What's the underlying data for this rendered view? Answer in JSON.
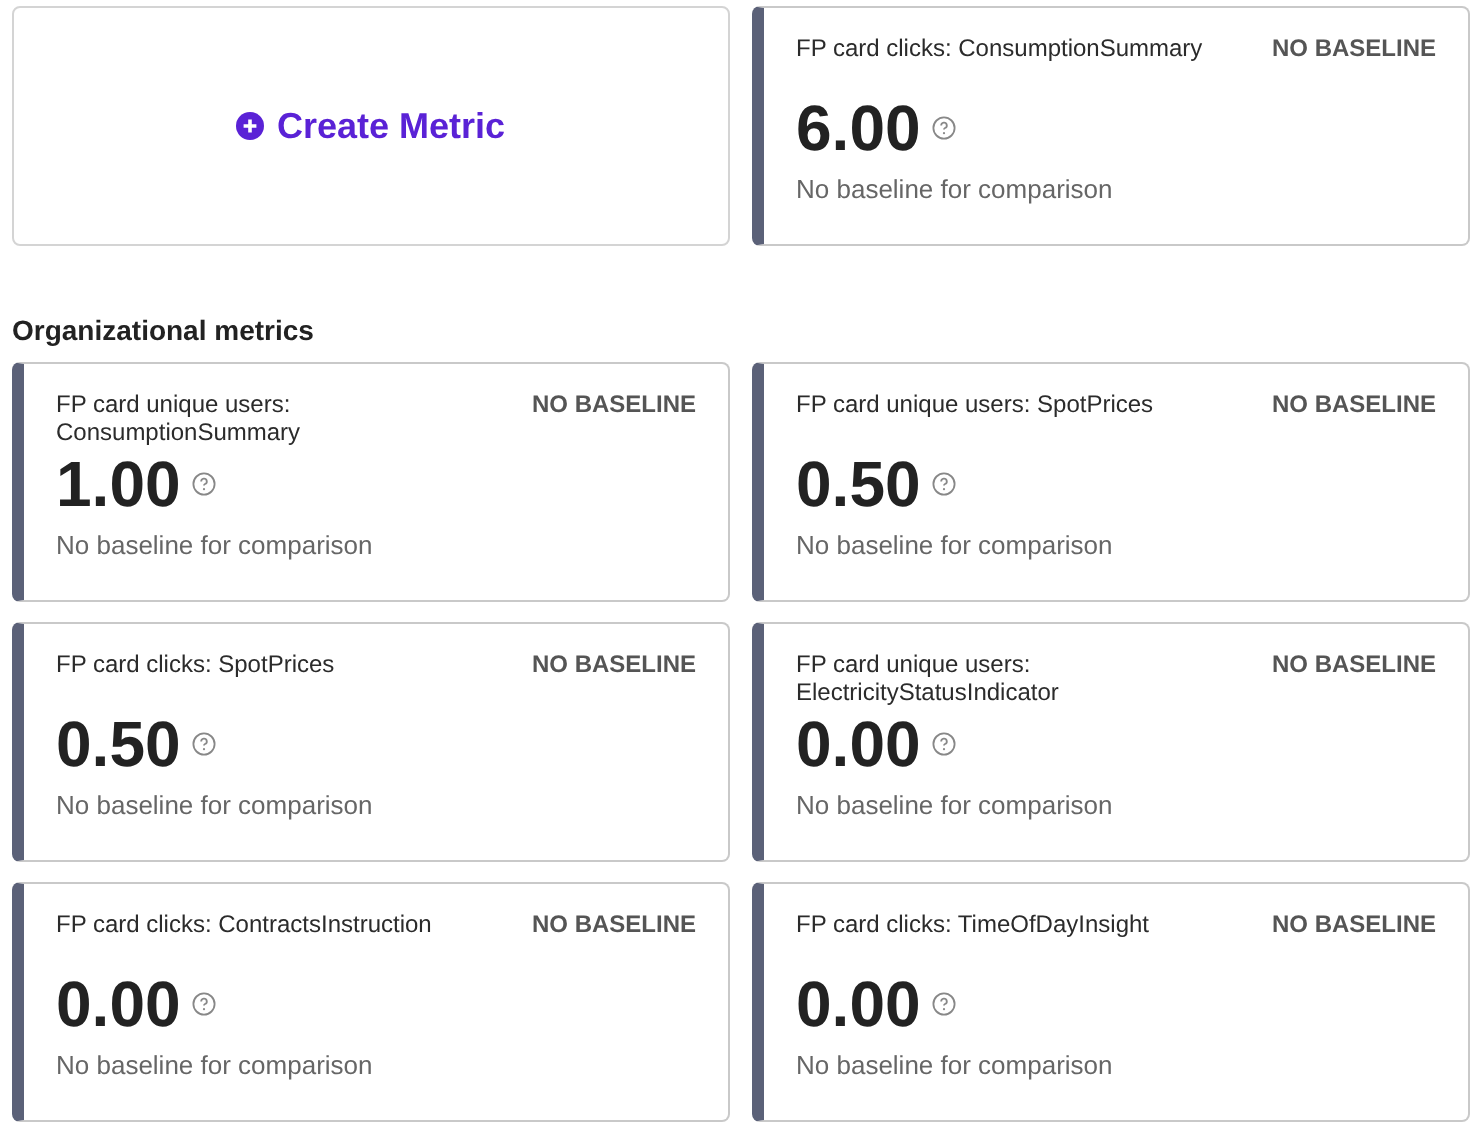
{
  "create_metric": {
    "label": "Create Metric"
  },
  "top_metrics": [
    {
      "title": "FP card clicks: ConsumptionSummary",
      "badge": "NO BASELINE",
      "value": "6.00",
      "note": "No baseline for comparison"
    }
  ],
  "section_title": "Organizational metrics",
  "metrics": [
    {
      "title": "FP card unique users: ConsumptionSummary",
      "badge": "NO BASELINE",
      "value": "1.00",
      "note": "No baseline for comparison"
    },
    {
      "title": "FP card unique users: SpotPrices",
      "badge": "NO BASELINE",
      "value": "0.50",
      "note": "No baseline for comparison"
    },
    {
      "title": "FP card clicks: SpotPrices",
      "badge": "NO BASELINE",
      "value": "0.50",
      "note": "No baseline for comparison"
    },
    {
      "title": "FP card unique users: ElectricityStatusIndicator",
      "badge": "NO BASELINE",
      "value": "0.00",
      "note": "No baseline for comparison"
    },
    {
      "title": "FP card clicks: ContractsInstruction",
      "badge": "NO BASELINE",
      "value": "0.00",
      "note": "No baseline for comparison"
    },
    {
      "title": "FP card clicks: TimeOfDayInsight",
      "badge": "NO BASELINE",
      "value": "0.00",
      "note": "No baseline for comparison"
    }
  ]
}
